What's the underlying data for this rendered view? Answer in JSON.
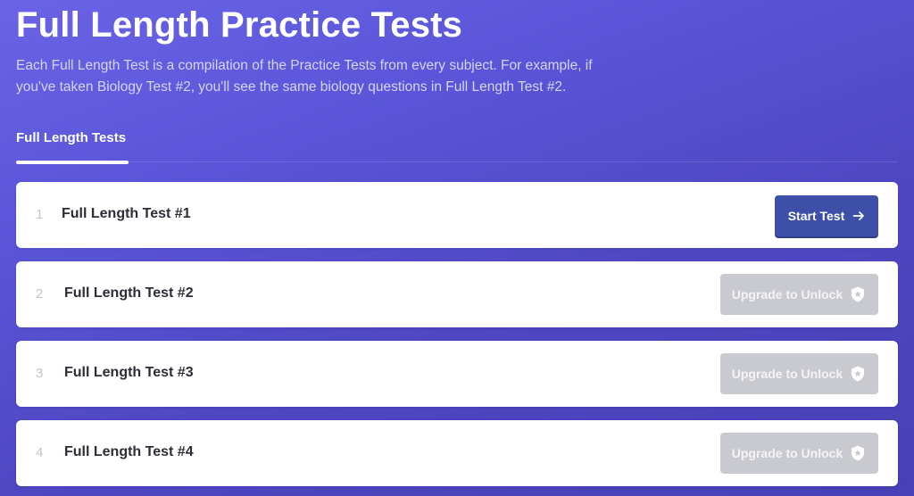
{
  "header": {
    "title": "Full Length Practice Tests",
    "description": "Each Full Length Test is a compilation of the Practice Tests from every subject. For example, if you've taken Biology Test #2, you'll see the same biology questions in Full Length Test #2."
  },
  "tabs": [
    {
      "label": "Full Length Tests",
      "active": true
    }
  ],
  "tests": [
    {
      "index": "1",
      "name": "Full Length Test #1",
      "action_label": "Start Test",
      "locked": false
    },
    {
      "index": "2",
      "name": "Full Length Test #2",
      "action_label": "Upgrade to Unlock",
      "locked": true
    },
    {
      "index": "3",
      "name": "Full Length Test #3",
      "action_label": "Upgrade to Unlock",
      "locked": true
    },
    {
      "index": "4",
      "name": "Full Length Test #4",
      "action_label": "Upgrade to Unlock",
      "locked": true
    }
  ],
  "icons": {
    "start_action": "arrow-right-icon",
    "locked_action": "shield-star-icon"
  },
  "colors": {
    "background_start": "#6a63e6",
    "background_end": "#4740b6",
    "primary_button": "#3e4fa8",
    "disabled_button": "#c9cad0",
    "row_background": "#ffffff",
    "index_text": "#c2c4cc",
    "row_text": "#2b2d38"
  }
}
